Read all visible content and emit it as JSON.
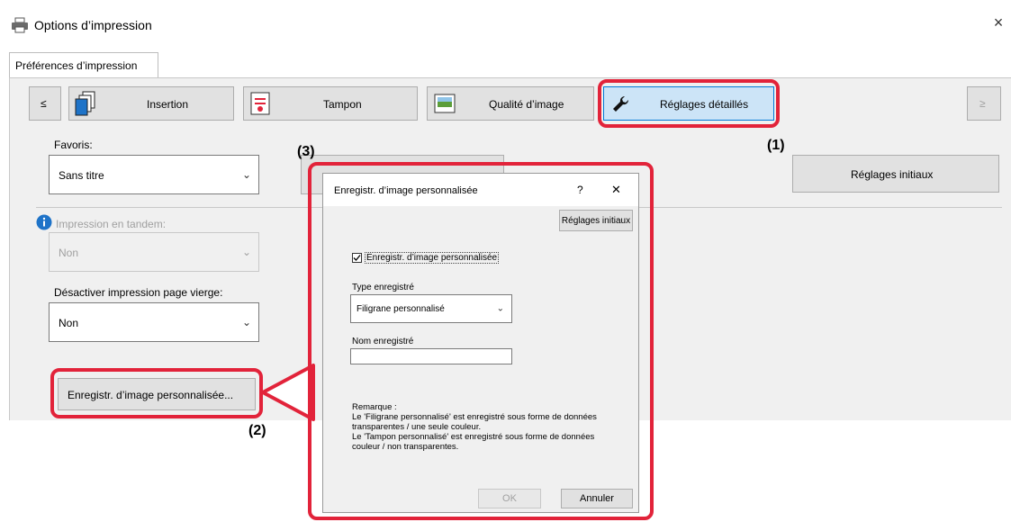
{
  "window": {
    "title": "Options d’impression",
    "close": "×"
  },
  "tabs": [
    {
      "label": "Préférences d’impression"
    }
  ],
  "nav": {
    "prev": "≤",
    "next": "≥",
    "items": [
      {
        "label": "Insertion",
        "icon": "pages-icon"
      },
      {
        "label": "Tampon",
        "icon": "stamp-icon"
      },
      {
        "label": "Qualité d’image",
        "icon": "image-quality-icon"
      },
      {
        "label": "Réglages détaillés",
        "icon": "wrench-icon"
      }
    ]
  },
  "left": {
    "favoris_label": "Favoris:",
    "favoris_value": "Sans titre",
    "tandem_label": "Impression en tandem:",
    "tandem_value": "Non",
    "blank_label": "Désactiver impression page vierge:",
    "blank_value": "Non",
    "register_button": "Enregistr. d’image personnalisée..."
  },
  "right": {
    "initial_button": "Réglages initiaux"
  },
  "callouts": {
    "c1": "(1)",
    "c2": "(2)",
    "c3": "(3)"
  },
  "dialog": {
    "title": "Enregistr. d’image personnalisée",
    "help": "?",
    "close": "✕",
    "initial_button": "Réglages initiaux",
    "checkbox_label": "Enregistr. d’image personnalisée",
    "checkbox_checked": true,
    "type_label": "Type enregistré",
    "type_value": "Filigrane personnalisé",
    "name_label": "Nom enregistré",
    "name_value": "",
    "remark_title": "Remarque :",
    "remark_1": "Le 'Filigrane personnalisé' est enregistré sous forme de données",
    "remark_2": "transparentes / une seule couleur.",
    "remark_3": "Le 'Tampon personnalisé' est enregistré sous forme de données",
    "remark_4": "couleur / non transparentes.",
    "ok": "OK",
    "cancel": "Annuler"
  },
  "colors": {
    "highlight": "#e2233a",
    "info": "#1e73c8"
  }
}
